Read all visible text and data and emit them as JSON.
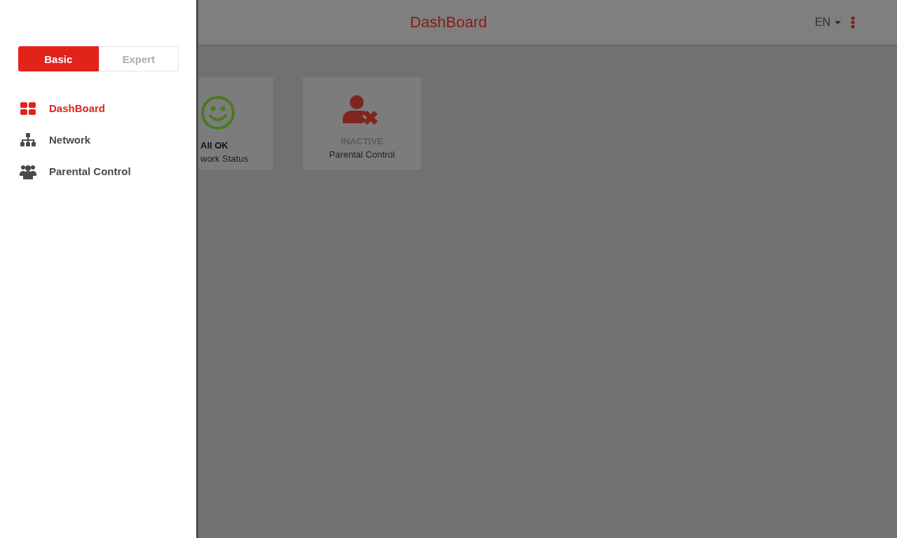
{
  "header": {
    "title": "DashBoard",
    "language": "EN"
  },
  "cards": [
    {
      "kind": "ok",
      "status": "All OK",
      "label": "work Status"
    },
    {
      "kind": "inactive",
      "status": "INACTIVE",
      "label": "Parental Control"
    }
  ],
  "drawer": {
    "modes": [
      {
        "label": "Basic",
        "selected": true
      },
      {
        "label": "Expert",
        "selected": false
      }
    ],
    "items": [
      {
        "kind": "dashboard",
        "label": "DashBoard",
        "selected": true
      },
      {
        "kind": "network",
        "label": "Network",
        "selected": false
      },
      {
        "kind": "family",
        "label": "Parental Control",
        "selected": false
      }
    ]
  }
}
